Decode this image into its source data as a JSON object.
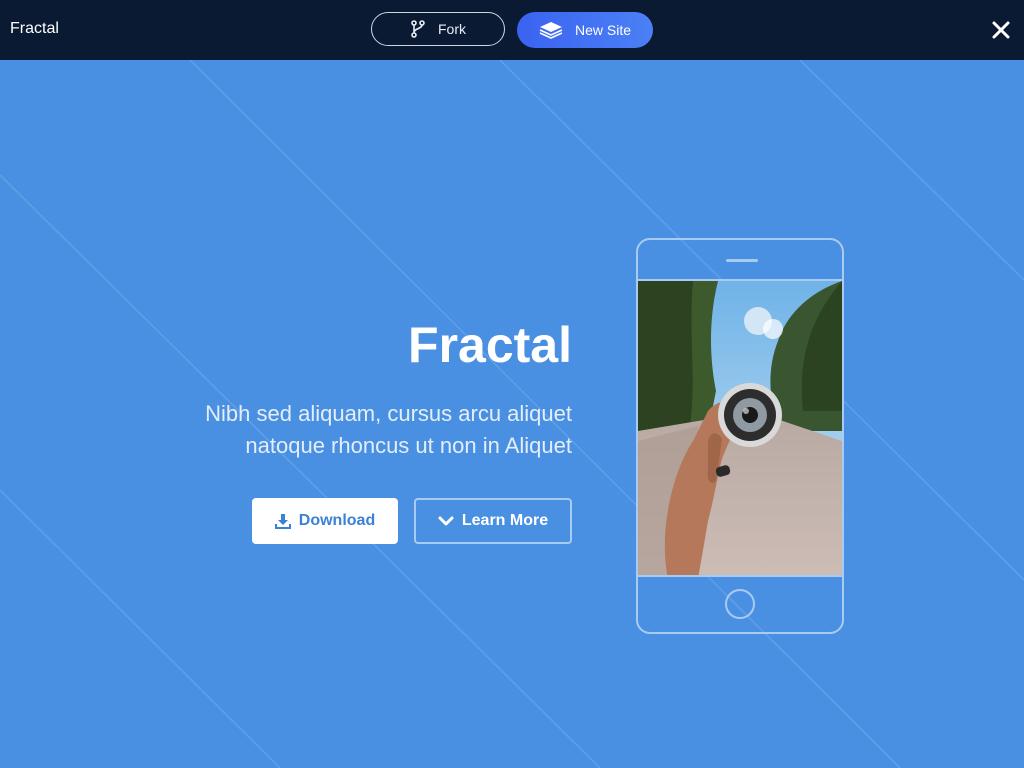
{
  "topbar": {
    "brand": "Fractal",
    "fork_label": "Fork",
    "new_site_label": "New Site",
    "close_icon": "close-icon"
  },
  "hero": {
    "title": "Fractal",
    "subtitle_line1": "Nibh sed aliquam, cursus arcu aliquet",
    "subtitle_line2": "natoque rhoncus ut non in Aliquet",
    "download_label": "Download",
    "learn_more_label": "Learn More",
    "image": "hand holding camera lens on road"
  },
  "colors": {
    "topbar_bg": "#0a1a33",
    "hero_bg": "#4a90e2",
    "accent": "#3a63f0",
    "download_text": "#3b82d6"
  }
}
